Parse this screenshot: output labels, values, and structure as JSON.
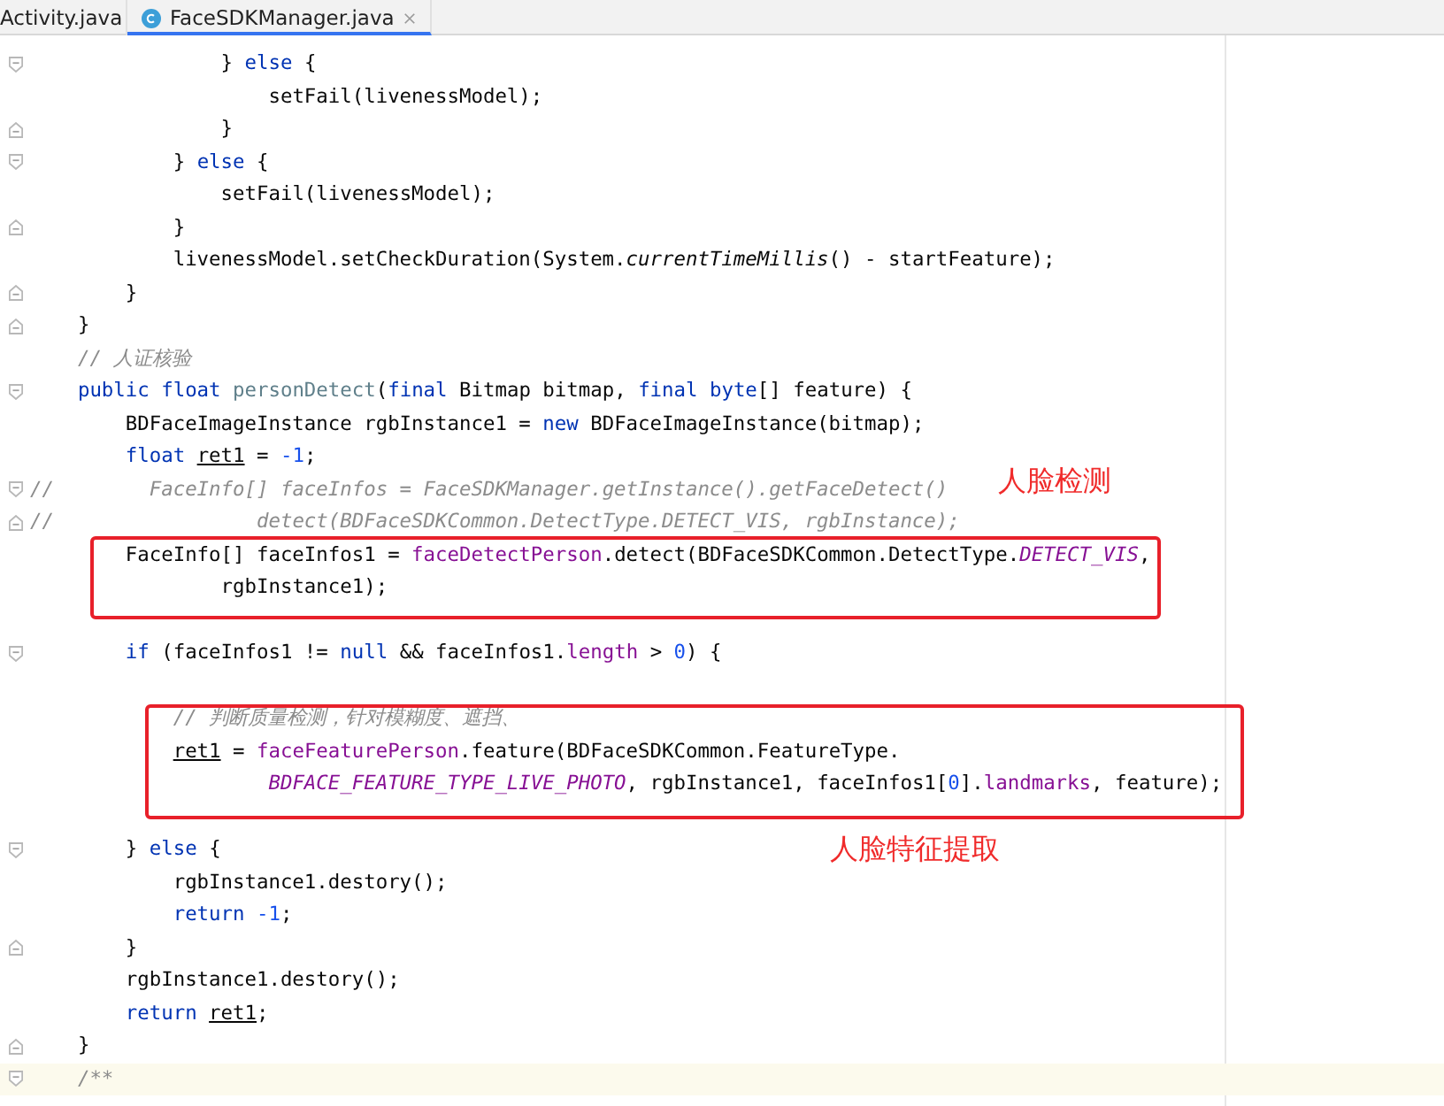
{
  "tabs": [
    {
      "label": "Activity.java",
      "selected": false,
      "icon": false
    },
    {
      "label": "FaceSDKManager.java",
      "selected": true,
      "icon": true
    }
  ],
  "editor": {
    "lines": [
      {
        "kind": "code",
        "fold_start": true,
        "segments": [
          {
            "kind": "plain",
            "text": "                } "
          },
          {
            "kind": "keyword",
            "text": "else"
          },
          {
            "kind": "plain",
            "text": " {"
          }
        ]
      },
      {
        "kind": "code",
        "segments": [
          {
            "kind": "plain",
            "text": "                    setFail(livenessModel);"
          }
        ]
      },
      {
        "kind": "code",
        "fold_end": true,
        "segments": [
          {
            "kind": "plain",
            "text": "                }"
          }
        ]
      },
      {
        "kind": "code",
        "fold_start": true,
        "segments": [
          {
            "kind": "plain",
            "text": "            } "
          },
          {
            "kind": "keyword",
            "text": "else"
          },
          {
            "kind": "plain",
            "text": " {"
          }
        ]
      },
      {
        "kind": "code",
        "segments": [
          {
            "kind": "plain",
            "text": "                setFail(livenessModel);"
          }
        ]
      },
      {
        "kind": "code",
        "fold_end": true,
        "segments": [
          {
            "kind": "plain",
            "text": "            }"
          }
        ]
      },
      {
        "kind": "code",
        "segments": [
          {
            "kind": "plain",
            "text": "            livenessModel.setCheckDuration(System."
          },
          {
            "kind": "static",
            "text": "currentTimeMillis"
          },
          {
            "kind": "plain",
            "text": "() - startFeature);"
          }
        ]
      },
      {
        "kind": "code",
        "fold_end": true,
        "segments": [
          {
            "kind": "plain",
            "text": "        }"
          }
        ]
      },
      {
        "kind": "code",
        "fold_end": true,
        "segments": [
          {
            "kind": "plain",
            "text": "    }"
          }
        ]
      },
      {
        "kind": "code",
        "segments": [
          {
            "kind": "comment",
            "text": "    // 人证核验"
          }
        ]
      },
      {
        "kind": "code",
        "fold_start": true,
        "segments": [
          {
            "kind": "keyword",
            "text": "    public float "
          },
          {
            "kind": "method",
            "text": "personDetect"
          },
          {
            "kind": "plain",
            "text": "("
          },
          {
            "kind": "keyword",
            "text": "final"
          },
          {
            "kind": "plain",
            "text": " Bitmap bitmap, "
          },
          {
            "kind": "keyword",
            "text": "final byte"
          },
          {
            "kind": "plain",
            "text": "[] feature) {"
          }
        ]
      },
      {
        "kind": "code",
        "segments": [
          {
            "kind": "plain",
            "text": "        BDFaceImageInstance rgbInstance1 = "
          },
          {
            "kind": "keyword",
            "text": "new"
          },
          {
            "kind": "plain",
            "text": " BDFaceImageInstance(bitmap);"
          }
        ]
      },
      {
        "kind": "code",
        "segments": [
          {
            "kind": "keyword",
            "text": "        float "
          },
          {
            "kind": "reassigned",
            "text": "ret1"
          },
          {
            "kind": "plain",
            "text": " = "
          },
          {
            "kind": "number",
            "text": "-1"
          },
          {
            "kind": "plain",
            "text": ";"
          }
        ]
      },
      {
        "kind": "code",
        "fold_start": true,
        "segments": [
          {
            "kind": "comment",
            "text": "//"
          },
          {
            "kind": "disabled",
            "text": "        FaceInfo[] faceInfos = FaceSDKManager.getInstance().getFaceDetect()"
          }
        ]
      },
      {
        "kind": "code",
        "fold_end": true,
        "segments": [
          {
            "kind": "comment",
            "text": "//"
          },
          {
            "kind": "disabled",
            "text": "                 detect(BDFaceSDKCommon.DetectType.DETECT_VIS, rgbInstance);"
          }
        ]
      },
      {
        "kind": "code",
        "segments": [
          {
            "kind": "plain",
            "text": "        FaceInfo[] faceInfos1 = "
          },
          {
            "kind": "field",
            "text": "faceDetectPerson"
          },
          {
            "kind": "plain",
            "text": ".detect(BDFaceSDKCommon.DetectType."
          },
          {
            "kind": "constant",
            "text": "DETECT_VIS"
          },
          {
            "kind": "plain",
            "text": ","
          }
        ]
      },
      {
        "kind": "code",
        "segments": [
          {
            "kind": "plain",
            "text": "                rgbInstance1);"
          }
        ]
      },
      {
        "kind": "blank"
      },
      {
        "kind": "code",
        "fold_start": true,
        "segments": [
          {
            "kind": "keyword",
            "text": "        if"
          },
          {
            "kind": "plain",
            "text": " (faceInfos1 != "
          },
          {
            "kind": "keyword",
            "text": "null"
          },
          {
            "kind": "plain",
            "text": " && faceInfos1."
          },
          {
            "kind": "field",
            "text": "length"
          },
          {
            "kind": "plain",
            "text": " > "
          },
          {
            "kind": "number",
            "text": "0"
          },
          {
            "kind": "plain",
            "text": ") {"
          }
        ]
      },
      {
        "kind": "blank"
      },
      {
        "kind": "code",
        "segments": [
          {
            "kind": "comment",
            "text": "            // 判断质量检测，针对模糊度、遮挡、"
          }
        ]
      },
      {
        "kind": "code",
        "segments": [
          {
            "kind": "reassigned",
            "text": "            ret1"
          },
          {
            "kind": "plain",
            "text": " = "
          },
          {
            "kind": "field",
            "text": "faceFeaturePerson"
          },
          {
            "kind": "plain",
            "text": ".feature(BDFaceSDKCommon.FeatureType."
          }
        ]
      },
      {
        "kind": "code",
        "segments": [
          {
            "kind": "constant",
            "text": "                    BDFACE_FEATURE_TYPE_LIVE_PHOTO"
          },
          {
            "kind": "plain",
            "text": ", rgbInstance1, faceInfos1["
          },
          {
            "kind": "number",
            "text": "0"
          },
          {
            "kind": "plain",
            "text": "]."
          },
          {
            "kind": "field",
            "text": "landmarks"
          },
          {
            "kind": "plain",
            "text": ", feature);"
          }
        ]
      },
      {
        "kind": "blank"
      },
      {
        "kind": "code",
        "fold_start": true,
        "segments": [
          {
            "kind": "plain",
            "text": "        } "
          },
          {
            "kind": "keyword",
            "text": "else"
          },
          {
            "kind": "plain",
            "text": " {"
          }
        ]
      },
      {
        "kind": "code",
        "segments": [
          {
            "kind": "plain",
            "text": "            rgbInstance1.destory();"
          }
        ]
      },
      {
        "kind": "code",
        "segments": [
          {
            "kind": "keyword",
            "text": "            return "
          },
          {
            "kind": "number",
            "text": "-1"
          },
          {
            "kind": "plain",
            "text": ";"
          }
        ]
      },
      {
        "kind": "code",
        "fold_end": true,
        "segments": [
          {
            "kind": "plain",
            "text": "        }"
          }
        ]
      },
      {
        "kind": "code",
        "segments": [
          {
            "kind": "plain",
            "text": "        rgbInstance1.destory();"
          }
        ]
      },
      {
        "kind": "code",
        "segments": [
          {
            "kind": "keyword",
            "text": "        return "
          },
          {
            "kind": "reassigned",
            "text": "ret1"
          },
          {
            "kind": "plain",
            "text": ";"
          }
        ]
      },
      {
        "kind": "code",
        "fold_end": true,
        "segments": [
          {
            "kind": "plain",
            "text": "    }"
          }
        ]
      },
      {
        "kind": "code",
        "fold_start": true,
        "current": true,
        "segments": [
          {
            "kind": "comment",
            "text": "    /**"
          }
        ]
      }
    ]
  },
  "annotations": [
    {
      "label": "人脸检测"
    },
    {
      "label": "人脸特征提取"
    }
  ]
}
